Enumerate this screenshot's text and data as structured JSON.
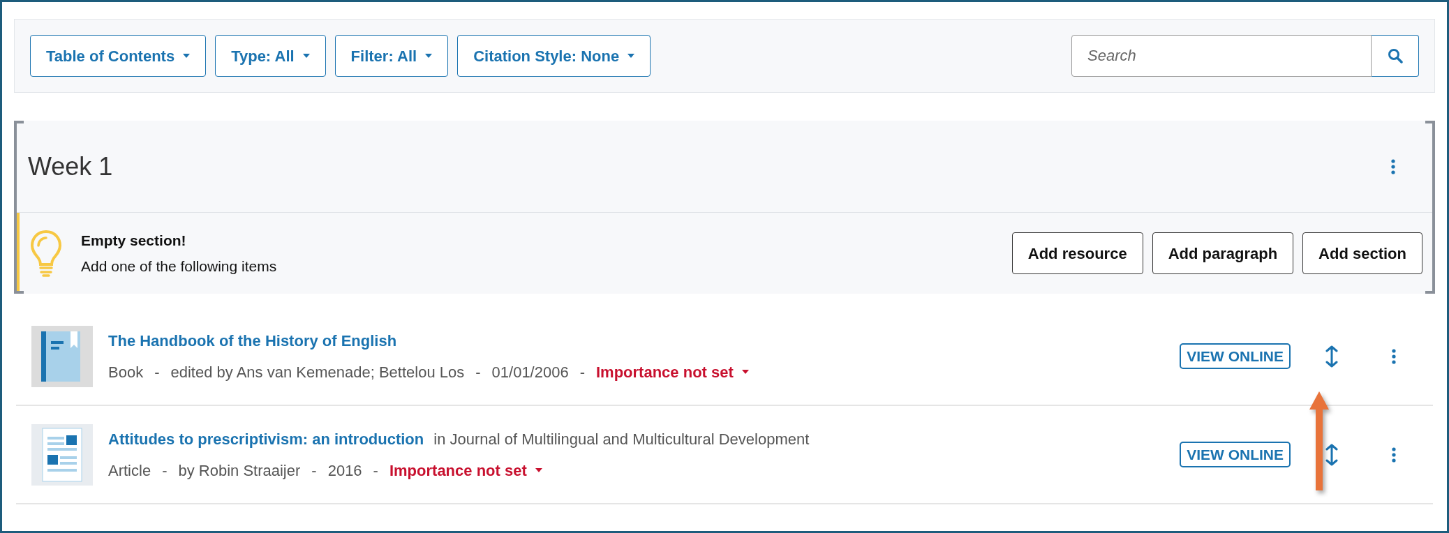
{
  "toolbar": {
    "dropdowns": [
      {
        "label": "Table of Contents"
      },
      {
        "label": "Type: All"
      },
      {
        "label": "Filter: All"
      },
      {
        "label": "Citation Style: None"
      }
    ],
    "search": {
      "placeholder": "Search"
    }
  },
  "section": {
    "title": "Week 1",
    "notice": {
      "title": "Empty section!",
      "text": "Add one of the following items"
    },
    "actions": [
      "Add resource",
      "Add paragraph",
      "Add section"
    ]
  },
  "separator": "-",
  "resources": [
    {
      "kind": "book",
      "title": "The Handbook of the History of English",
      "meta": [
        "Book",
        "edited by Ans van Kemenade; Bettelou Los",
        "01/01/2006"
      ],
      "importance": "Importance not set",
      "view_label": "VIEW ONLINE"
    },
    {
      "kind": "article",
      "title": "Attitudes to prescriptivism: an introduction",
      "source": "in Journal of Multilingual and Multicultural Development",
      "meta": [
        "Article",
        "by Robin Straaijer",
        "2016"
      ],
      "importance": "Importance not set",
      "view_label": "VIEW ONLINE"
    }
  ],
  "annotation": {
    "kind": "arrow",
    "color": "#e8733a"
  }
}
